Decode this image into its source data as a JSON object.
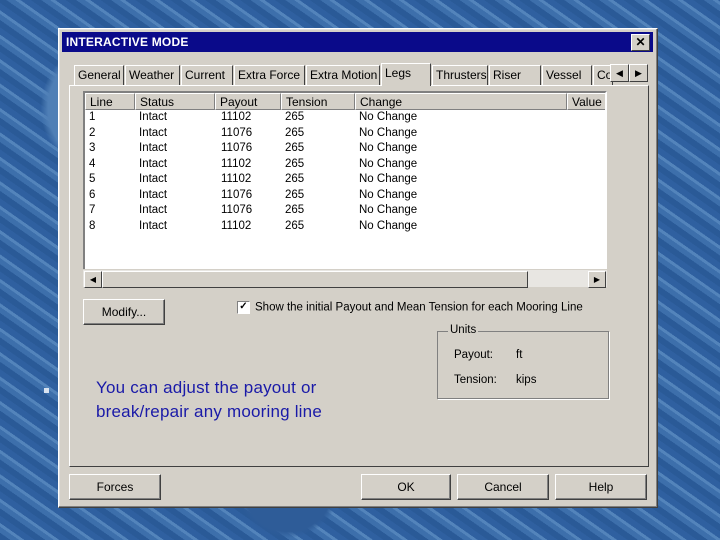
{
  "window": {
    "title": "INTERACTIVE MODE",
    "close_icon": "close-icon"
  },
  "tabs": [
    {
      "label": "General"
    },
    {
      "label": "Weather"
    },
    {
      "label": "Current"
    },
    {
      "label": "Extra Force"
    },
    {
      "label": "Extra Motion"
    },
    {
      "label": "Legs",
      "active": true
    },
    {
      "label": "Thrusters"
    },
    {
      "label": "Riser"
    },
    {
      "label": "Vessel"
    },
    {
      "label": "Co"
    }
  ],
  "table": {
    "columns": [
      "Line",
      "Status",
      "Payout",
      "Tension",
      "Change",
      "Value"
    ],
    "rows": [
      [
        "1",
        "Intact",
        "11102",
        "265",
        "No Change",
        ""
      ],
      [
        "2",
        "Intact",
        "11076",
        "265",
        "No Change",
        ""
      ],
      [
        "3",
        "Intact",
        "11076",
        "265",
        "No Change",
        ""
      ],
      [
        "4",
        "Intact",
        "11102",
        "265",
        "No Change",
        ""
      ],
      [
        "5",
        "Intact",
        "11102",
        "265",
        "No Change",
        ""
      ],
      [
        "6",
        "Intact",
        "11076",
        "265",
        "No Change",
        ""
      ],
      [
        "7",
        "Intact",
        "11076",
        "265",
        "No Change",
        ""
      ],
      [
        "8",
        "Intact",
        "11102",
        "265",
        "No Change",
        ""
      ]
    ]
  },
  "modify_button": "Modify...",
  "show_initial": {
    "checked": true,
    "label": "Show the initial Payout and Mean Tension for each Mooring Line"
  },
  "units": {
    "legend": "Units",
    "payout_label": "Payout:",
    "payout_value": "ft",
    "tension_label": "Tension:",
    "tension_value": "kips"
  },
  "caption": "You can adjust the payout or break/repair any mooring line",
  "buttons": {
    "forces": "Forces",
    "ok": "OK",
    "cancel": "Cancel",
    "help": "Help"
  }
}
